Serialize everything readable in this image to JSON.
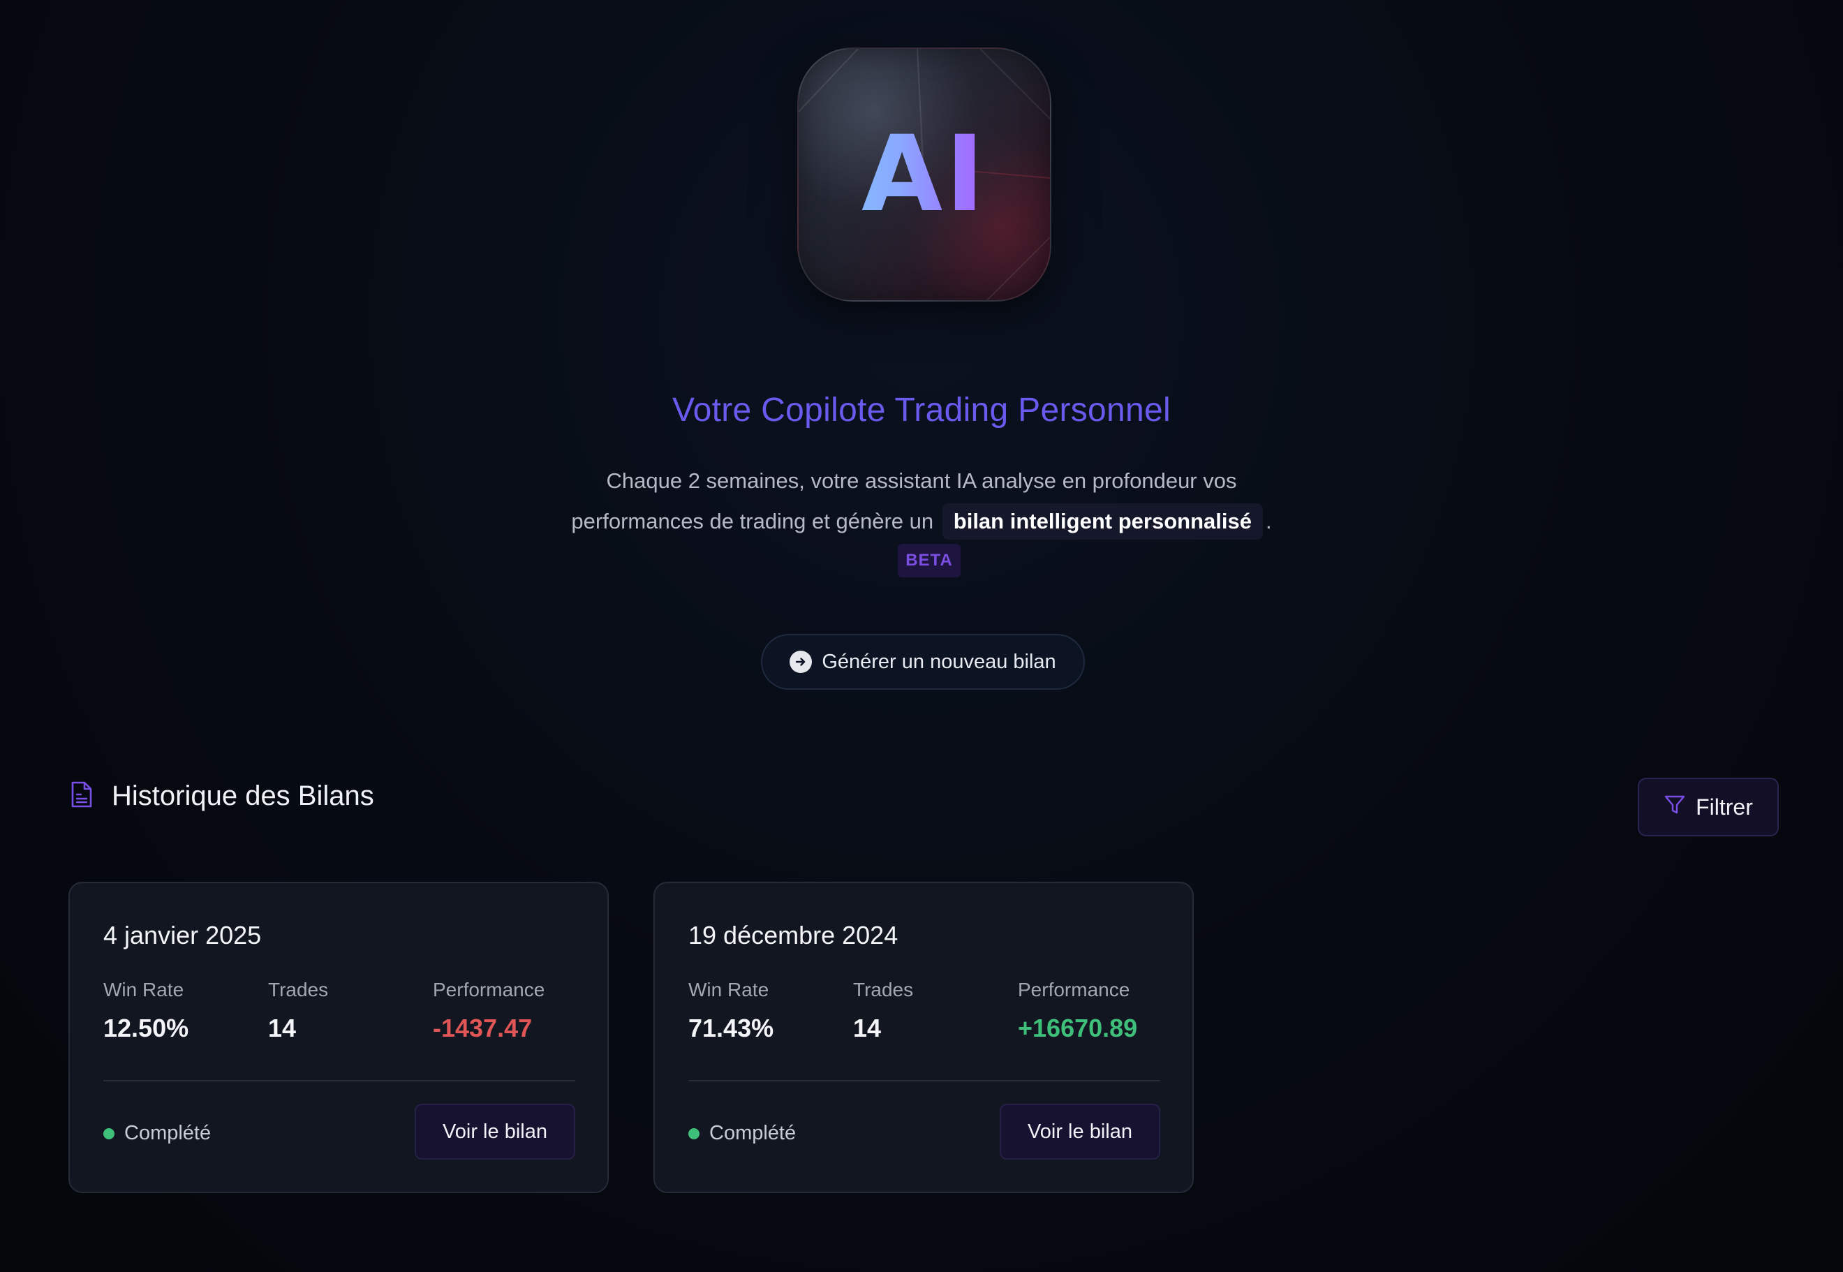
{
  "logo": {
    "text": "AI"
  },
  "hero": {
    "title": "Votre Copilote Trading Personnel",
    "desc_part1": "Chaque 2 semaines, votre assistant IA analyse en profondeur vos performances de trading et génère un",
    "desc_highlight": "bilan intelligent personnalisé",
    "desc_end": ".",
    "badge": "BETA",
    "generate_label": "Générer un nouveau bilan"
  },
  "history": {
    "title": "Historique des Bilans",
    "filter_label": "Filtrer",
    "cards": [
      {
        "date": "4 janvier 2025",
        "win_rate_label": "Win Rate",
        "win_rate": "12.50%",
        "trades_label": "Trades",
        "trades": "14",
        "performance_label": "Performance",
        "performance": "-1437.47",
        "status": "Complété",
        "view_label": "Voir le bilan"
      },
      {
        "date": "19 décembre 2024",
        "win_rate_label": "Win Rate",
        "win_rate": "71.43%",
        "trades_label": "Trades",
        "trades": "14",
        "performance_label": "Performance",
        "performance": "+16670.89",
        "status": "Complété",
        "view_label": "Voir le bilan"
      }
    ]
  },
  "colors": {
    "accent": "#6a5bef",
    "negative": "#e05656",
    "positive": "#3fc07a",
    "background": "#05080f"
  },
  "icons": {
    "generate": "arrow-right-circle-icon",
    "history": "document-icon",
    "filter": "filter-funnel-icon",
    "status": "status-dot"
  }
}
